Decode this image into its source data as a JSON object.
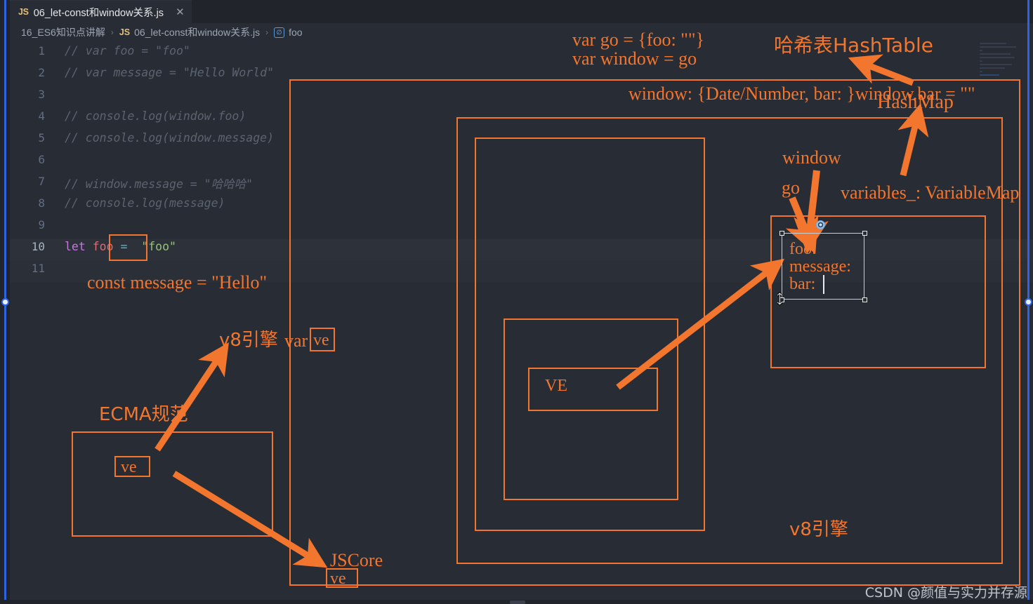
{
  "window": {
    "tab": {
      "badge": "JS",
      "title": "06_let-const和window关系.js",
      "close": "✕"
    },
    "breadcrumb": {
      "folder": "16_ES6知识点讲解",
      "sep": "›",
      "file_badge": "JS",
      "file": "06_let-const和window关系.js",
      "symbol_icon": "∅",
      "symbol": "foo"
    }
  },
  "editor": {
    "lines": [
      {
        "n": "1",
        "text": "// var foo = \"foo\""
      },
      {
        "n": "2",
        "text": "// var message = \"Hello World\""
      },
      {
        "n": "3",
        "text": ""
      },
      {
        "n": "4",
        "text": "// console.log(window.foo)"
      },
      {
        "n": "5",
        "text": "// console.log(window.message)"
      },
      {
        "n": "6",
        "text": ""
      },
      {
        "n": "7",
        "text": "// window.message = \"哈哈哈\""
      },
      {
        "n": "8",
        "text": "// console.log(message)"
      },
      {
        "n": "9",
        "text": ""
      },
      {
        "n": "10",
        "text": "let foo = \"foo\""
      },
      {
        "n": "11",
        "text": ""
      }
    ],
    "line10": {
      "kw": "let",
      "name": "foo",
      "eq": "=",
      "value": "\"foo\""
    }
  },
  "annotations": {
    "go_decl_line1": "var go = {foo: \"\"}",
    "go_decl_line2": "var window = go",
    "hashtable": "哈希表HashTable",
    "window_obj": "window: {Date/Number, bar: }window.bar = \"\"",
    "hashmap": "HashMap",
    "window_label": "window",
    "go_label": "go",
    "variables_map": "variables_: VariableMap",
    "const_message": "const message = \"Hello\"",
    "v8_engine_left": "v8引擎",
    "var_ve": "var",
    "ve_box_top": "ve",
    "ecma_spec": "ECMA规范",
    "ve_box_ecma": "ve",
    "jscore": "JSCore",
    "ve_box_jscore": "ve",
    "ve_center": "VE",
    "v8_engine_right": "v8引擎",
    "textbox": {
      "line1": "foo:",
      "line2": "message:",
      "line3": "bar:"
    }
  },
  "watermark": "CSDN @颜值与实力并存源",
  "colors": {
    "annotation_orange": "#f2762e",
    "editor_bg": "#282c34",
    "chrome_bg": "#21252b",
    "guide_blue": "#2f63e0"
  }
}
